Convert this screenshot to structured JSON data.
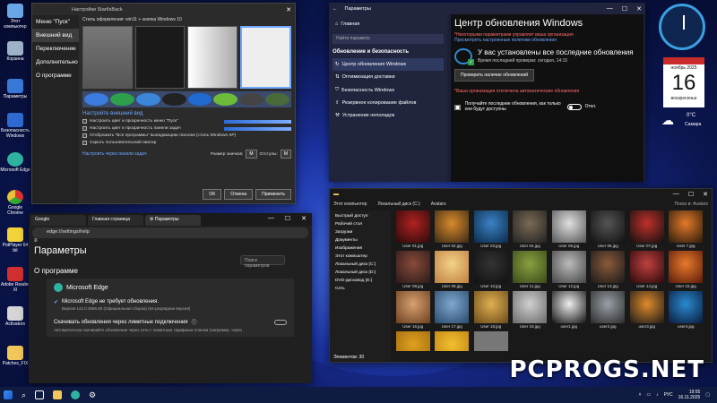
{
  "desktop_icons": [
    {
      "label": "Этот компьютер",
      "icon": "computer-icon",
      "color": "#6aa7e8"
    },
    {
      "label": "Корзина",
      "icon": "trash-icon",
      "color": "#9fb3c8"
    },
    {
      "label": "Параметры",
      "icon": "gear-icon",
      "color": "#3a78d8"
    },
    {
      "label": "Безопасность Windows",
      "icon": "shield-icon",
      "color": "#2f6ad0"
    },
    {
      "label": "Microsoft Edge",
      "icon": "edge-icon",
      "color": "#2fb3a0"
    },
    {
      "label": "Google Chrome",
      "icon": "chrome-icon",
      "color": "#e8c23a"
    },
    {
      "label": "PotPlayer 64 bit",
      "icon": "potplayer-icon",
      "color": "#f3d33a"
    },
    {
      "label": "Adobe Reader XI",
      "icon": "pdf-icon",
      "color": "#d23030"
    },
    {
      "label": "Activators",
      "icon": "activator-icon",
      "color": "#d5d5d5"
    },
    {
      "label": "Patches_FIX",
      "icon": "folder-icon",
      "color": "#f1c75b"
    }
  ],
  "sib": {
    "title": "Настройки StartIsBack",
    "side_items": [
      "Меню \"Пуск\"",
      "Внешний вид",
      "Переключение",
      "Дополнительно",
      "О программе"
    ],
    "style_label": "Стиль оформления: win11 + кнопка Windows 10",
    "appearance_header": "Настройте внешний вид",
    "options": [
      "Настроить цвет и прозрачность меню \"Пуск\"",
      "Настроить цвет и прозрачность панели задач",
      "Отображать \"Все программы\" выпадающим списком (стиль Windows XP)",
      "Скрыть пользовательский аватар"
    ],
    "custom_link": "Настроить через панели задач",
    "icon_size_label": "Размер значков:",
    "icon_size_value": "M",
    "padding_label": "Отступы:",
    "padding_value": "M",
    "buttons": {
      "ok": "ОК",
      "cancel": "Отмена",
      "apply": "Применить"
    }
  },
  "settings": {
    "title": "Параметры",
    "home": "Главная",
    "search_placeholder": "Найти параметр",
    "section": "Обновление и безопасность",
    "nav_items": [
      "Центр обновления Windows",
      "Оптимизация доставки",
      "Безопасность Windows",
      "Резервное копирование файлов",
      "Устранение неполадок"
    ],
    "heading": "Центр обновления Windows",
    "org_note": "*Некоторыми параметрами управляет ваша организация",
    "policies_link": "Просмотреть настроенные политики обновления",
    "status_title": "У вас установлены все последние обновления",
    "last_check": "Время последней проверки: сегодня, 14:15",
    "check_button": "Проверить наличие обновлений",
    "auto_off_note": "*Ваша организация отключила автоматические обновления",
    "get_latest": "Получайте последние обновления, как только они будут доступны",
    "toggle_label": "Откл."
  },
  "widgets": {
    "month": "ноябрь 2025",
    "day": "16",
    "weekday": "воскресенье",
    "temp": "0°C",
    "city": "Самара"
  },
  "edge": {
    "tabs": [
      "Google",
      "Главная страница",
      "Параметры"
    ],
    "url": "edge://settings/help",
    "heading": "Параметры",
    "search_placeholder": "Поиск параметров",
    "about": "О программе",
    "product": "Microsoft Edge",
    "status": "Microsoft Edge не требует обновления.",
    "version": "Версия 142.0.3595.80 (Официальная сборка) (64-разрядная версия)",
    "metered": "Скачивать обновления через лимитные подключения",
    "metered_note": "Автоматически скачивайте обновления через сети с лимитным тарифным планом (например, через"
  },
  "explorer": {
    "crumbs": [
      "Этот компьютер",
      "Локальный диск (C:)",
      "Avatars"
    ],
    "search_placeholder": "Поиск в: Avatars",
    "tree": [
      "Быстрый доступ",
      "Рабочий стол",
      "Загрузки",
      "Документы",
      "Изображения",
      "Этот компьютер",
      "Локальный диск (C:)",
      "Локальный диск (D:)",
      "DVD-дисковод (E:)",
      "Сеть"
    ],
    "files": [
      {
        "name": "User 01.jpg",
        "c1": "#b22222",
        "c2": "#2a0a0a"
      },
      {
        "name": "User 02.jpg",
        "c1": "#d98a2b",
        "c2": "#3a2a15"
      },
      {
        "name": "User 03.jpg",
        "c1": "#3b82c4",
        "c2": "#0b2a4a"
      },
      {
        "name": "User 04.jpg",
        "c1": "#7a6a55",
        "c2": "#222"
      },
      {
        "name": "User 05.jpg",
        "c1": "#e0e0e0",
        "c2": "#555"
      },
      {
        "name": "User 06.jpg",
        "c1": "#555",
        "c2": "#111"
      },
      {
        "name": "User 07.jpg",
        "c1": "#c0302a",
        "c2": "#111"
      },
      {
        "name": "User 7.jpg",
        "c1": "#e27a2a",
        "c2": "#2a1a0a"
      },
      {
        "name": "User 08.jpg",
        "c1": "#8a4a3a",
        "c2": "#2a1a1a"
      },
      {
        "name": "User 09.jpg",
        "c1": "#f2d28a",
        "c2": "#c08040"
      },
      {
        "name": "User 10.jpg",
        "c1": "#333",
        "c2": "#111"
      },
      {
        "name": "User 11.jpg",
        "c1": "#8aa040",
        "c2": "#3a4a1a"
      },
      {
        "name": "User 12.jpg",
        "c1": "#bbbbbb",
        "c2": "#444"
      },
      {
        "name": "User 13.jpg",
        "c1": "#8a5a3a",
        "c2": "#1a1a1a"
      },
      {
        "name": "User 14.jpg",
        "c1": "#c04040",
        "c2": "#2a0a0a"
      },
      {
        "name": "User 15.jpg",
        "c1": "#e87a2a",
        "c2": "#5a1a0a"
      },
      {
        "name": "User 16.jpg",
        "c1": "#d8a070",
        "c2": "#6a4020"
      },
      {
        "name": "User 17.jpg",
        "c1": "#7fa8d0",
        "c2": "#2a4a6a"
      },
      {
        "name": "User 18.jpg",
        "c1": "#e0b050",
        "c2": "#6a4a1a"
      },
      {
        "name": "User 19.jpg",
        "c1": "#d0d0d0",
        "c2": "#6a6a6a"
      },
      {
        "name": "user1.jpg",
        "c1": "#eeeeee",
        "c2": "#111"
      },
      {
        "name": "user2.jpg",
        "c1": "#9aa0a8",
        "c2": "#2a2a2a"
      },
      {
        "name": "user3.jpg",
        "c1": "#e08a2a",
        "c2": "#1a1a1a"
      },
      {
        "name": "user4.jpg",
        "c1": "#2a8ad0",
        "c2": "#0a1a3a"
      },
      {
        "name": "",
        "c1": "#e0a020",
        "c2": "#a06a10"
      },
      {
        "name": "",
        "c1": "#f0c030",
        "c2": "#c08010"
      },
      {
        "name": "",
        "c1": "#777",
        "c2": "#777"
      }
    ],
    "status": "Элементов: 30"
  },
  "watermark": "PCPROGS.NET",
  "tray": {
    "lang": "РУС",
    "time": "19:55",
    "date": "16.11.2025"
  }
}
